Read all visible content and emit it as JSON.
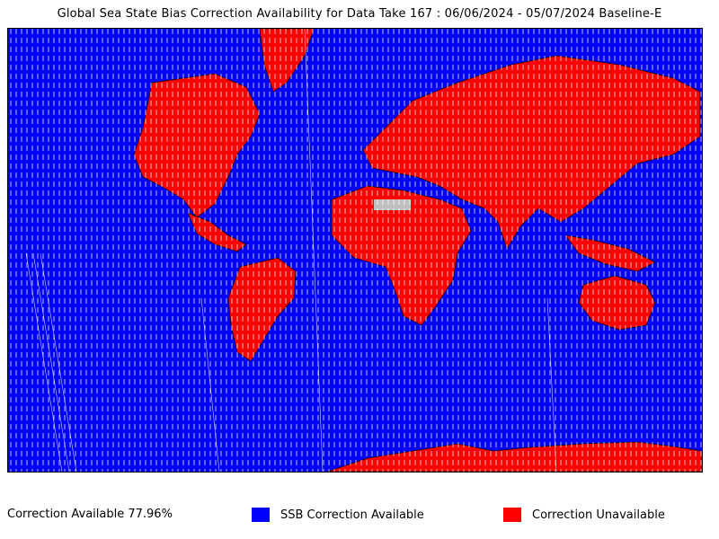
{
  "title": "Global Sea State Bias Correction Availability for Data Take 167 : 06/06/2024 - 05/07/2024 Baseline-E",
  "map": {
    "colors": {
      "available": "#0000ff",
      "unavailable": "#ff0000",
      "no_data": "#c0c0c0",
      "track_lines": "#ffffff",
      "coastline": "#000000"
    }
  },
  "footer": {
    "stat_text": "Correction Available 77.96%"
  },
  "legend": [
    {
      "label": "SSB Correction Available",
      "color": "#0000ff"
    },
    {
      "label": "Correction Unavailable",
      "color": "#ff0000"
    }
  ]
}
